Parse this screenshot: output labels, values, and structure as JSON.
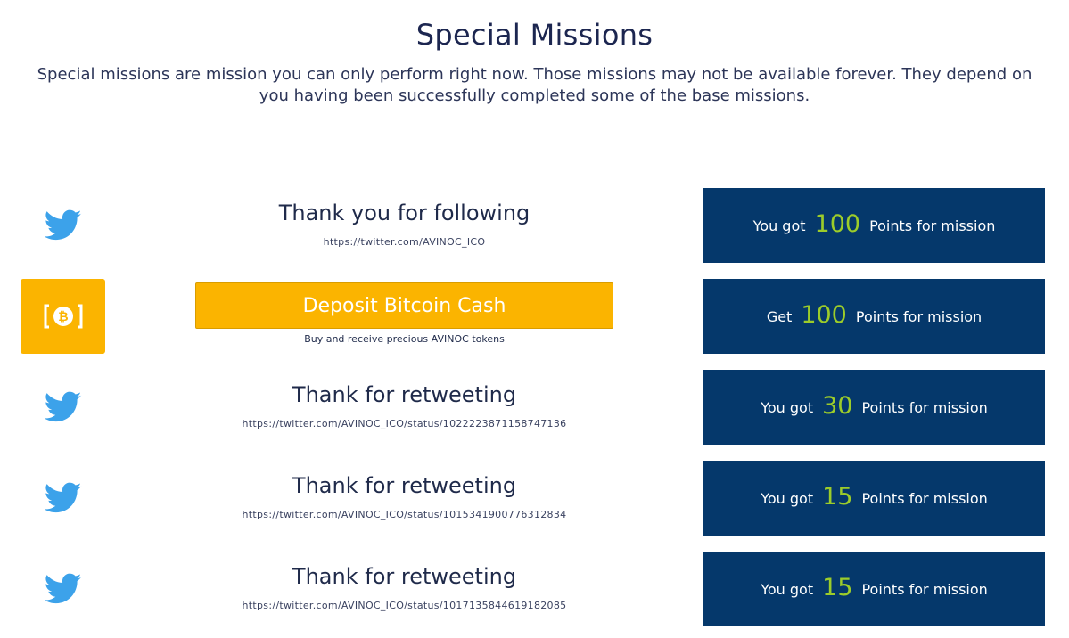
{
  "header": {
    "title": "Special Missions",
    "description": "Special missions are mission you can only perform right now. Those missions may not be available forever. They depend on you having been successfully completed some of the base missions."
  },
  "colors": {
    "twitter_blue": "#3ca2ea",
    "bitcoin_cash_orange": "#fbb400",
    "panel_navy": "#05386b",
    "points_green": "#9ccc2a"
  },
  "missions": [
    {
      "icon": "twitter-icon",
      "title": "Thank you for following",
      "url": "https://twitter.com/AVINOC_ICO",
      "points_prefix": "You got",
      "points": "100",
      "points_suffix": "Points for mission"
    },
    {
      "icon": "bitcoin-cash-icon",
      "button_label": "Deposit Bitcoin Cash",
      "subtitle": "Buy and receive precious AVINOC tokens",
      "points_prefix": "Get",
      "points": "100",
      "points_suffix": "Points for mission"
    },
    {
      "icon": "twitter-icon",
      "title": "Thank for retweeting",
      "url": "https://twitter.com/AVINOC_ICO/status/1022223871158747136",
      "points_prefix": "You got",
      "points": "30",
      "points_suffix": "Points for mission"
    },
    {
      "icon": "twitter-icon",
      "title": "Thank for retweeting",
      "url": "https://twitter.com/AVINOC_ICO/status/1015341900776312834",
      "points_prefix": "You got",
      "points": "15",
      "points_suffix": "Points for mission"
    },
    {
      "icon": "twitter-icon",
      "title": "Thank for retweeting",
      "url": "https://twitter.com/AVINOC_ICO/status/1017135844619182085",
      "points_prefix": "You got",
      "points": "15",
      "points_suffix": "Points for mission"
    }
  ]
}
